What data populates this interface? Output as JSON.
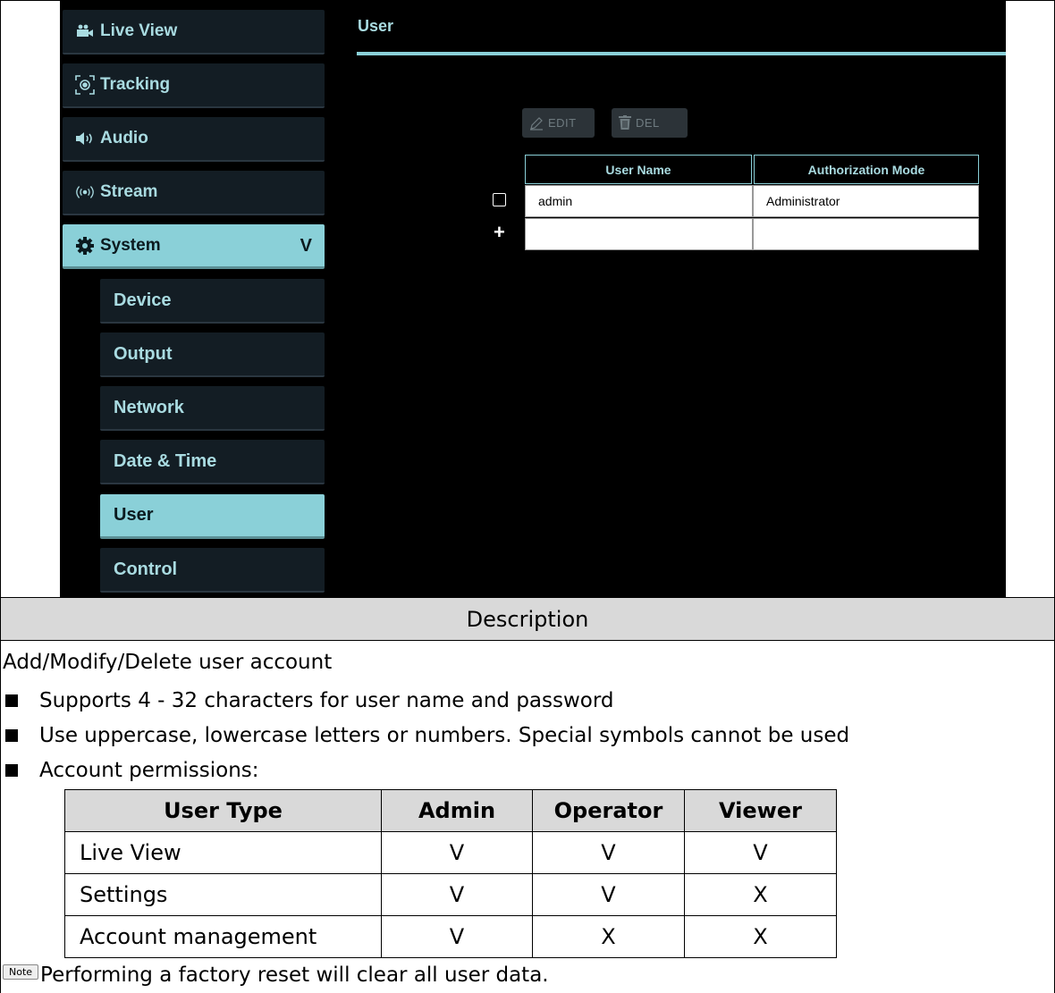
{
  "sidebar": {
    "items": [
      {
        "label": "Live View",
        "icon": "camera-icon"
      },
      {
        "label": "Tracking",
        "icon": "tracking-icon"
      },
      {
        "label": "Audio",
        "icon": "speaker-icon"
      },
      {
        "label": "Stream",
        "icon": "broadcast-icon"
      },
      {
        "label": "System",
        "icon": "gear-icon",
        "chevron": "V"
      }
    ],
    "sub_items": [
      {
        "label": "Device"
      },
      {
        "label": "Output"
      },
      {
        "label": "Network"
      },
      {
        "label": "Date & Time"
      },
      {
        "label": "User",
        "active": true
      },
      {
        "label": "Control"
      }
    ]
  },
  "main": {
    "title": "User",
    "toolbar": {
      "edit_label": "EDIT",
      "del_label": "DEL"
    },
    "table": {
      "headers": [
        "User Name",
        "Authorization Mode"
      ],
      "rows": [
        {
          "user_name": "admin",
          "mode": "Administrator"
        }
      ],
      "add_symbol": "+"
    }
  },
  "description": {
    "header": "Description",
    "intro": "Add/Modify/Delete user account",
    "bullets": [
      "Supports 4 - 32 characters for user name and password",
      "Use uppercase, lowercase letters or numbers. Special symbols cannot be used",
      "Account permissions:"
    ],
    "permissions": {
      "headers": [
        "User Type",
        "Admin",
        "Operator",
        "Viewer"
      ],
      "rows": [
        [
          "Live View",
          "V",
          "V",
          "V"
        ],
        [
          "Settings",
          "V",
          "V",
          "X"
        ],
        [
          "Account management",
          "V",
          "X",
          "X"
        ]
      ]
    },
    "note_badge": "Note",
    "note_text": "Performing a factory reset will clear all user data."
  },
  "colors": {
    "accent": "#8ad0d8",
    "nav_bg": "#131d24",
    "text_accent": "#a9dbe1",
    "header_gray": "#d9d9d9"
  }
}
